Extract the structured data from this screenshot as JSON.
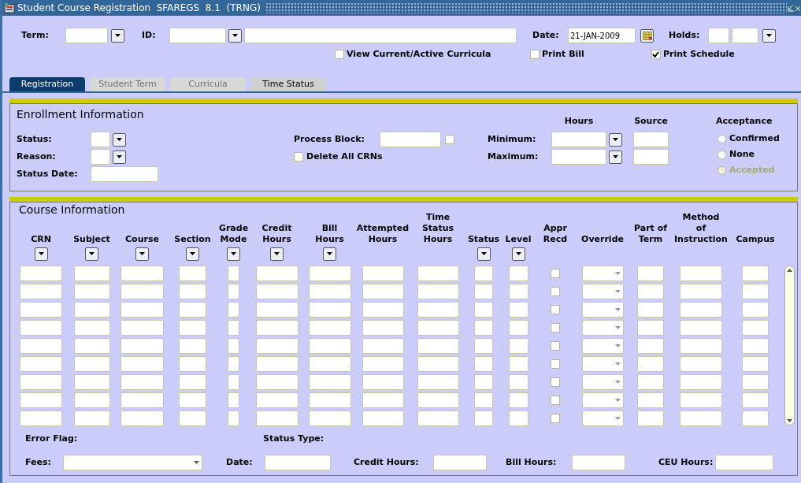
{
  "window": {
    "title": "Student Course Registration  SFAREGS  8.1  (TRNG)"
  },
  "key_block": {
    "term_label": "Term:",
    "id_label": "ID:",
    "date": {
      "label": "Date:",
      "value": "21-JAN-2009"
    },
    "holds_label": "Holds:",
    "options": [
      {
        "label": "View Current/Active Curricula",
        "checked": false
      },
      {
        "label": "Print Bill",
        "checked": false
      },
      {
        "label": "Print Schedule",
        "checked": true
      }
    ]
  },
  "tabs": [
    {
      "label": "Registration",
      "selected": true,
      "disabled": false
    },
    {
      "label": "Student Term",
      "selected": false,
      "disabled": true
    },
    {
      "label": "Curricula",
      "selected": false,
      "disabled": true
    },
    {
      "label": "Time Status",
      "selected": false,
      "disabled": false
    }
  ],
  "enrollment": {
    "title": "Enrollment Information",
    "status_label": "Status:",
    "reason_label": "Reason:",
    "status_date_label": "Status Date:",
    "process_block": {
      "label": "Process Block:",
      "checked": false
    },
    "delete_all_crns": {
      "label": "Delete All CRNs",
      "checked": false
    },
    "hours_heading": "Hours",
    "source_heading": "Source",
    "minimum_label": "Minimum:",
    "maximum_label": "Maximum:",
    "acceptance": {
      "heading": "Acceptance",
      "options": [
        {
          "label": "Confirmed",
          "selected": false,
          "disabled": false
        },
        {
          "label": "None",
          "selected": false,
          "disabled": false
        },
        {
          "label": "Accepted",
          "selected": false,
          "disabled": true
        }
      ]
    }
  },
  "course": {
    "title": "Course Information",
    "columns": [
      {
        "label": "CRN",
        "kind": "text",
        "has_list": true
      },
      {
        "label": "Subject",
        "kind": "text",
        "has_list": true
      },
      {
        "label": "Course",
        "kind": "text",
        "has_list": true
      },
      {
        "label": "Section",
        "kind": "text",
        "has_list": true
      },
      {
        "label": "Grade\nMode",
        "kind": "text",
        "has_list": true
      },
      {
        "label": "Credit\nHours",
        "kind": "text",
        "has_list": true
      },
      {
        "label": "Bill\nHours",
        "kind": "text",
        "has_list": true
      },
      {
        "label": "Attempted\nHours",
        "kind": "text",
        "has_list": false
      },
      {
        "label": "Time\nStatus\nHours",
        "kind": "text",
        "has_list": false
      },
      {
        "label": "Status",
        "kind": "text",
        "has_list": true
      },
      {
        "label": "Level",
        "kind": "text",
        "has_list": true
      },
      {
        "label": "Appr\nRecd",
        "kind": "checkbox",
        "has_list": false
      },
      {
        "label": "Override",
        "kind": "select",
        "has_list": false
      },
      {
        "label": "Part of\nTerm",
        "kind": "text",
        "has_list": false
      },
      {
        "label": "Method\nof\nInstruction",
        "kind": "text",
        "has_list": false
      },
      {
        "label": "Campus",
        "kind": "text",
        "has_list": false
      }
    ],
    "rows": [
      {
        "appr_recd": false
      },
      {
        "appr_recd": false
      },
      {
        "appr_recd": false
      },
      {
        "appr_recd": false
      },
      {
        "appr_recd": false
      },
      {
        "appr_recd": false
      },
      {
        "appr_recd": false
      },
      {
        "appr_recd": false
      },
      {
        "appr_recd": false
      }
    ],
    "error_flag_label": "Error Flag:",
    "status_type_label": "Status Type:",
    "fees_label": "Fees:",
    "date_label": "Date:",
    "credit_hours_label": "Credit Hours:",
    "bill_hours_label": "Bill Hours:",
    "ceu_hours_label": "CEU Hours:"
  }
}
